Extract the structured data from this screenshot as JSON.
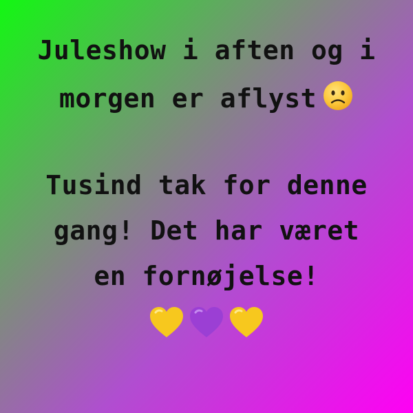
{
  "announcement": {
    "line1": "Juleshow i aften og i",
    "line2": "morgen er aflyst",
    "line3": "Tusind tak for denne",
    "line4": "gang! Det har været",
    "line5": "en fornøjelse!"
  },
  "icons": {
    "sad_face": "slightly-frowning-face-icon",
    "hearts": [
      "yellow-heart-icon",
      "purple-heart-icon",
      "yellow-heart-icon"
    ]
  },
  "colors": {
    "gradient_start": "#12f812",
    "gradient_end": "#ff00f4",
    "text": "#111111",
    "yellow_heart": "#f7c81e",
    "purple_heart": "#9b3fd4"
  }
}
